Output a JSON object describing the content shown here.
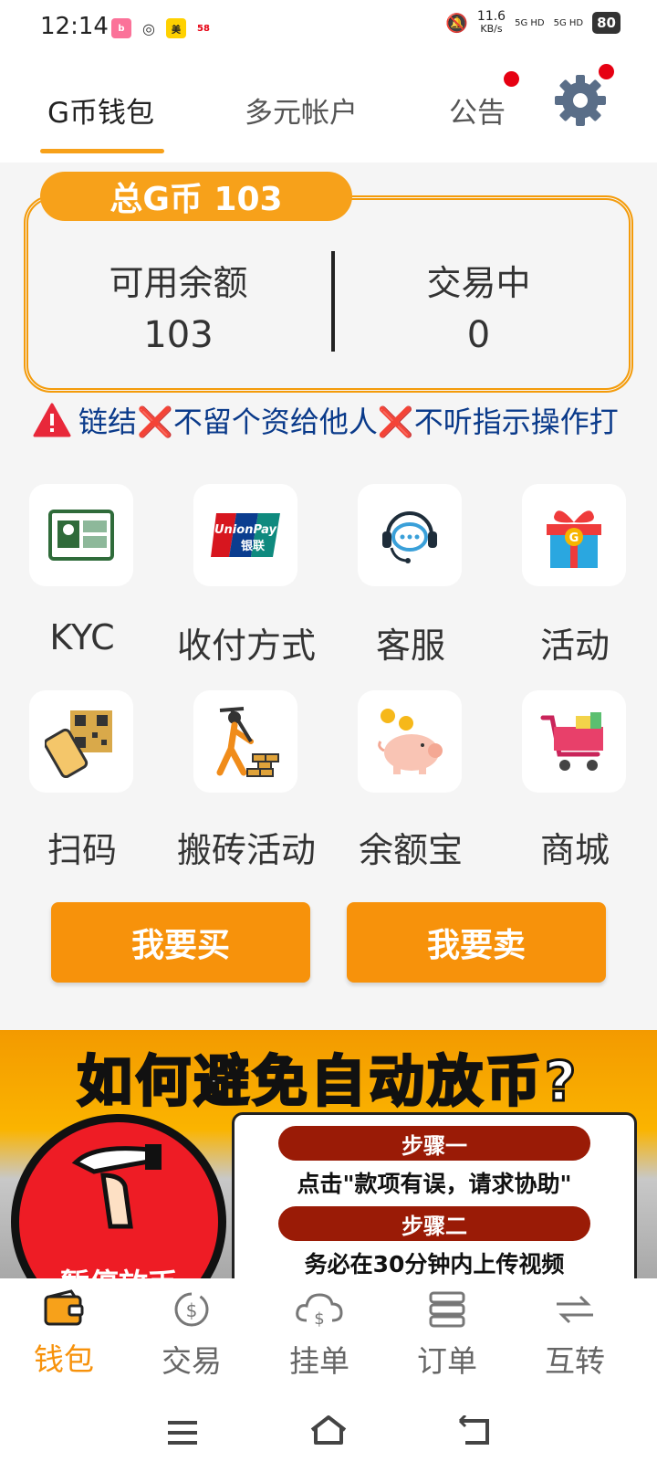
{
  "status_bar": {
    "time": "12:14",
    "net_speed": "11.6",
    "net_unit": "KB/s",
    "signal1": "5G HD",
    "signal2": "5G HD",
    "battery": "80",
    "app_icons": [
      "bilibili-icon",
      "wechat-icon",
      "meituan-icon",
      "58-icon"
    ]
  },
  "top_tabs": [
    {
      "label": "G币钱包",
      "active": true
    },
    {
      "label": "多元帐户",
      "active": false
    },
    {
      "label": "公告",
      "active": false
    }
  ],
  "balance": {
    "total_label": "总G币 103",
    "available_label": "可用余额",
    "available_value": "103",
    "trading_label": "交易中",
    "trading_value": "0"
  },
  "ticker": {
    "text": "链结❌不留个资给他人❌不听指示操作打"
  },
  "grid": [
    {
      "label": "KYC",
      "icon": "id-card-icon"
    },
    {
      "label": "收付方式",
      "icon": "unionpay-icon"
    },
    {
      "label": "客服",
      "icon": "customer-service-icon"
    },
    {
      "label": "活动",
      "icon": "gift-icon"
    },
    {
      "label": "扫码",
      "icon": "qr-scan-icon"
    },
    {
      "label": "搬砖活动",
      "icon": "brick-worker-icon"
    },
    {
      "label": "余额宝",
      "icon": "piggy-bank-icon"
    },
    {
      "label": "商城",
      "icon": "shopping-cart-icon"
    }
  ],
  "buttons": {
    "buy": "我要买",
    "sell": "我要卖"
  },
  "banner": {
    "title": "如何避免自动放币?",
    "circle_text": "暂停放币",
    "step1_label": "步骤一",
    "step1_text": "点击\"款项有误，请求协助\"",
    "step2_label": "步骤二",
    "step2_text": "务必在30分钟内上传视频"
  },
  "bottom_nav": [
    {
      "label": "钱包",
      "icon": "wallet-icon",
      "active": true
    },
    {
      "label": "交易",
      "icon": "exchange-dollar-icon",
      "active": false
    },
    {
      "label": "挂单",
      "icon": "cloud-dollar-icon",
      "active": false
    },
    {
      "label": "订单",
      "icon": "list-icon",
      "active": false
    },
    {
      "label": "互转",
      "icon": "transfer-icon",
      "active": false
    }
  ],
  "colors": {
    "accent": "#f7a11a",
    "button": "#f7920b",
    "ticker_text": "#0a3a8a",
    "badge": "#e60012"
  }
}
